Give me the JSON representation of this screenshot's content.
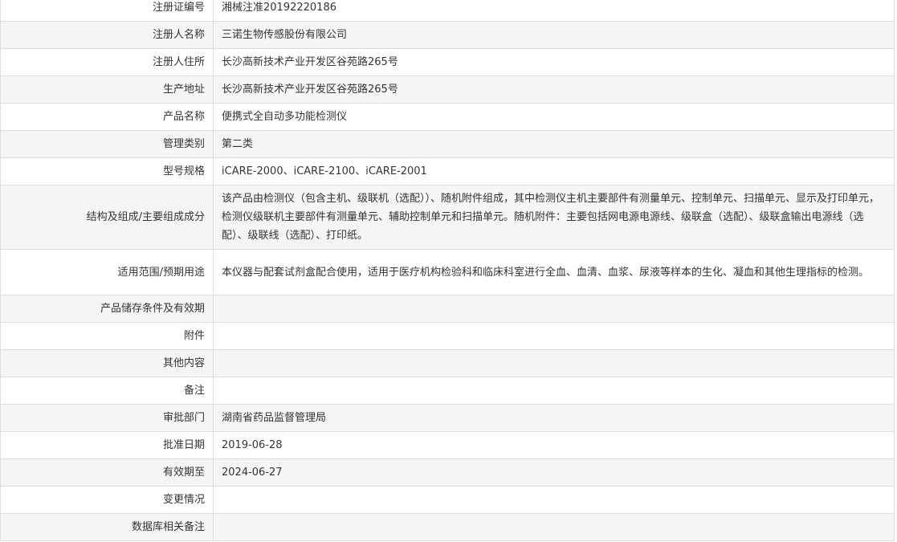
{
  "rows": [
    {
      "label": "注册证编号",
      "value": "湘械注准20192220186"
    },
    {
      "label": "注册人名称",
      "value": "三诺生物传感股份有限公司"
    },
    {
      "label": "注册人住所",
      "value": "长沙高新技术产业开发区谷苑路265号"
    },
    {
      "label": "生产地址",
      "value": "长沙高新技术产业开发区谷苑路265号"
    },
    {
      "label": "产品名称",
      "value": "便携式全自动多功能检测仪"
    },
    {
      "label": "管理类别",
      "value": "第二类"
    },
    {
      "label": "型号规格",
      "value": "iCARE-2000、iCARE-2100、iCARE-2001"
    },
    {
      "label": "结构及组成/主要组成成分",
      "value": "该产品由检测仪（包含主机、级联机（选配））、随机附件组成，其中检测仪主机主要部件有测量单元、控制单元、扫描单元、显示及打印单元，检测仪级联机主要部件有测量单元、辅助控制单元和扫描单元。随机附件：主要包括网电源电源线、级联盒（选配）、级联盒输出电源线（选配）、级联线（选配）、打印纸。"
    },
    {
      "label": "适用范围/预期用途",
      "value": "本仪器与配套试剂盒配合使用，适用于医疗机构检验科和临床科室进行全血、血清、血浆、尿液等样本的生化、凝血和其他生理指标的检测。"
    },
    {
      "label": "产品储存条件及有效期",
      "value": ""
    },
    {
      "label": "附件",
      "value": ""
    },
    {
      "label": "其他内容",
      "value": ""
    },
    {
      "label": "备注",
      "value": ""
    },
    {
      "label": "审批部门",
      "value": "湖南省药品监督管理局"
    },
    {
      "label": "批准日期",
      "value": "2019-06-28"
    },
    {
      "label": "有效期至",
      "value": "2024-06-27"
    },
    {
      "label": "变更情况",
      "value": ""
    },
    {
      "label": "数据库相关备注",
      "value": ""
    }
  ]
}
